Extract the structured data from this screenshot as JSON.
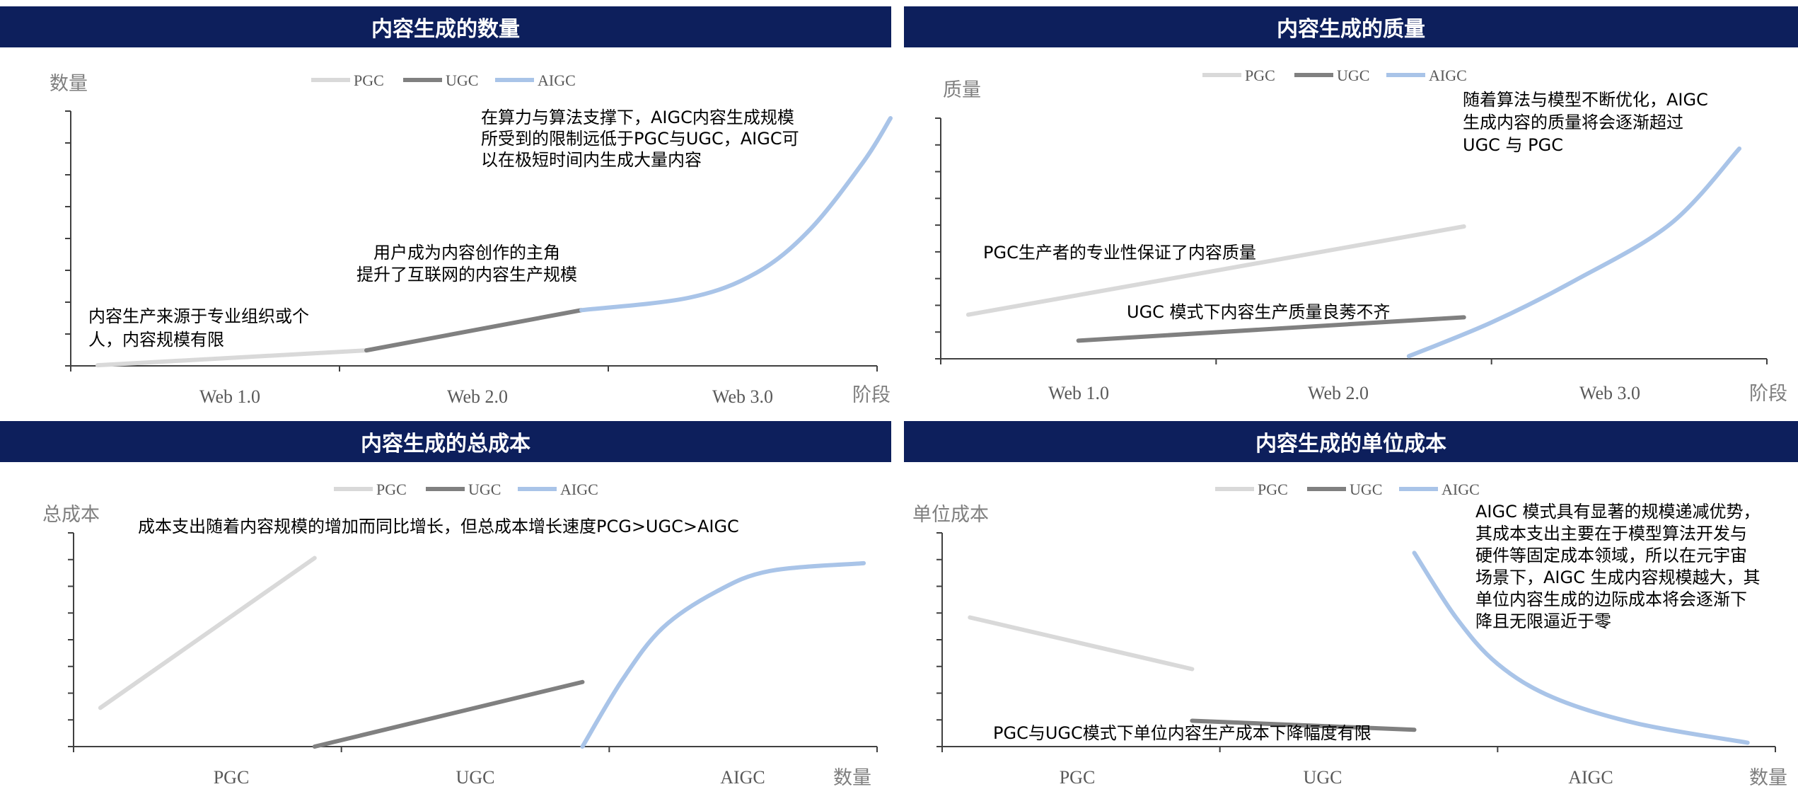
{
  "colors": {
    "banner": "#0d1f5c",
    "PGC": "#d9d9d9",
    "UGC": "#808080",
    "AIGC": "#a9c4e8"
  },
  "legend": [
    "PGC",
    "UGC",
    "AIGC"
  ],
  "panels": [
    {
      "title": "内容生成的数量",
      "ylabel": "数量",
      "xlabel": "阶段",
      "categories": [
        "Web 1.0",
        "Web 2.0",
        "Web 3.0"
      ],
      "annotations": [
        {
          "lines": [
            "在算力与算法支撑下，AIGC内容生成规模",
            "所受到的限制远低于PGC与UGC，AIGC可",
            "以在极短时间内生成大量内容"
          ]
        },
        {
          "lines": [
            "用户成为内容创作的主角",
            "提升了互联网的内容生产规模"
          ]
        },
        {
          "lines": [
            "内容生产来源于专业组织或个",
            "人，内容规模有限"
          ]
        }
      ]
    },
    {
      "title": "内容生成的质量",
      "ylabel": "质量",
      "xlabel": "阶段",
      "categories": [
        "Web 1.0",
        "Web 2.0",
        "Web 3.0"
      ],
      "annotations": [
        {
          "lines": [
            "随着算法与模型不断优化，AIGC",
            "生成内容的质量将会逐渐超过",
            "UGC 与 PGC"
          ]
        },
        {
          "lines": [
            "PGC生产者的专业性保证了内容质量"
          ]
        },
        {
          "lines": [
            "UGC 模式下内容生产质量良莠不齐"
          ]
        }
      ]
    },
    {
      "title": "内容生成的总成本",
      "ylabel": "总成本",
      "xlabel": "数量",
      "categories": [
        "PGC",
        "UGC",
        "AIGC"
      ],
      "annotations": [
        {
          "lines": [
            "成本支出随着内容规模的增加而同比增长，但总成本增长速度PCG>UGC>AIGC"
          ]
        }
      ]
    },
    {
      "title": "内容生成的单位成本",
      "ylabel": "单位成本",
      "xlabel": "数量",
      "categories": [
        "PGC",
        "UGC",
        "AIGC"
      ],
      "annotations": [
        {
          "lines": [
            "AIGC 模式具有显著的规模递减优势，",
            "其成本支出主要在于模型算法开发与",
            "硬件等固定成本领域，所以在元宇宙",
            "场景下，AIGC 生成内容规模越大，其",
            "单位内容生成的边际成本将会逐渐下",
            "降且无限逼近于零"
          ]
        },
        {
          "lines": [
            "PGC与UGC模式下单位内容生产成本下降幅度有限"
          ]
        }
      ]
    }
  ],
  "chart_data": [
    {
      "type": "line",
      "title": "内容生成的数量",
      "xlabel": "阶段",
      "ylabel": "数量",
      "categories": [
        "Web 1.0",
        "Web 2.0",
        "Web 3.0"
      ],
      "xlim": [
        0,
        3
      ],
      "ylim": [
        0,
        8
      ],
      "series": [
        {
          "name": "PGC",
          "points": [
            [
              0.1,
              0.02
            ],
            [
              1.1,
              0.5
            ]
          ]
        },
        {
          "name": "UGC",
          "points": [
            [
              1.1,
              0.5
            ],
            [
              1.9,
              1.8
            ]
          ]
        },
        {
          "name": "AIGC",
          "points": [
            [
              1.9,
              1.8
            ],
            [
              2.3,
              2.2
            ],
            [
              2.55,
              3.0
            ],
            [
              2.75,
              4.4
            ],
            [
              2.95,
              6.6
            ],
            [
              3.05,
              8.0
            ]
          ]
        }
      ]
    },
    {
      "type": "line",
      "title": "内容生成的质量",
      "xlabel": "阶段",
      "ylabel": "质量",
      "categories": [
        "Web 1.0",
        "Web 2.0",
        "Web 3.0"
      ],
      "xlim": [
        0,
        3
      ],
      "ylim": [
        0,
        9
      ],
      "series": [
        {
          "name": "PGC",
          "points": [
            [
              0.1,
              1.7
            ],
            [
              1.9,
              5.1
            ]
          ]
        },
        {
          "name": "UGC",
          "points": [
            [
              0.5,
              0.7
            ],
            [
              1.9,
              1.6
            ]
          ]
        },
        {
          "name": "AIGC",
          "points": [
            [
              1.7,
              0.1
            ],
            [
              2.0,
              1.4
            ],
            [
              2.3,
              3.0
            ],
            [
              2.65,
              5.2
            ],
            [
              2.9,
              8.1
            ]
          ]
        }
      ]
    },
    {
      "type": "line",
      "title": "内容生成的总成本",
      "xlabel": "数量",
      "ylabel": "总成本",
      "categories": [
        "PGC",
        "UGC",
        "AIGC"
      ],
      "xlim": [
        0,
        3
      ],
      "ylim": [
        0,
        8
      ],
      "series": [
        {
          "name": "PGC",
          "points": [
            [
              0.1,
              1.5
            ],
            [
              0.9,
              7.3
            ]
          ]
        },
        {
          "name": "UGC",
          "points": [
            [
              0.9,
              0.0
            ],
            [
              1.9,
              2.5
            ]
          ]
        },
        {
          "name": "AIGC",
          "points": [
            [
              1.9,
              0.0
            ],
            [
              2.05,
              2.6
            ],
            [
              2.2,
              4.6
            ],
            [
              2.4,
              6.0
            ],
            [
              2.6,
              6.8
            ],
            [
              2.95,
              7.1
            ]
          ]
        }
      ]
    },
    {
      "type": "line",
      "title": "内容生成的单位成本",
      "xlabel": "数量",
      "ylabel": "单位成本",
      "categories": [
        "PGC",
        "UGC",
        "AIGC"
      ],
      "xlim": [
        0,
        3
      ],
      "ylim": [
        0,
        8
      ],
      "series": [
        {
          "name": "PGC",
          "points": [
            [
              0.1,
              5.0
            ],
            [
              0.9,
              3.0
            ]
          ]
        },
        {
          "name": "UGC",
          "points": [
            [
              0.9,
              1.0
            ],
            [
              1.7,
              0.65
            ]
          ]
        },
        {
          "name": "AIGC",
          "points": [
            [
              1.7,
              7.5
            ],
            [
              1.85,
              5.0
            ],
            [
              2.0,
              3.2
            ],
            [
              2.2,
              1.9
            ],
            [
              2.5,
              0.9
            ],
            [
              2.9,
              0.15
            ]
          ]
        }
      ]
    }
  ]
}
